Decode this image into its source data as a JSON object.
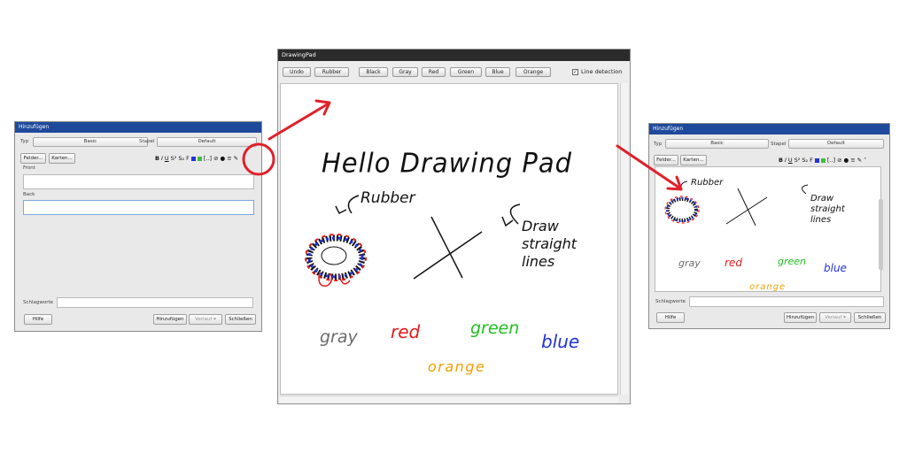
{
  "left_window": {
    "title": "Hinzufügen",
    "type_label": "Typ",
    "type_value": "Basic",
    "deck_label": "Stapel",
    "deck_value": "Default",
    "fields_button": "Felder...",
    "cards_button": "Karten...",
    "field_front": "Front",
    "field_back": "Back",
    "tags_label": "Schlagworte",
    "help_button": "Hilfe",
    "add_button": "Hinzufügen",
    "history_button": "Verlauf ▾",
    "close_button": "Schließen"
  },
  "right_window": {
    "title": "Hinzufügen",
    "type_label": "Typ",
    "type_value": "Basic",
    "deck_label": "Stapel",
    "deck_value": "Default",
    "fields_button": "Felder...",
    "cards_button": "Karten...",
    "tags_label": "Schlagworte",
    "help_button": "Hilfe",
    "add_button": "Hinzufügen",
    "history_button": "Verlauf ▾",
    "close_button": "Schließen",
    "drawing": {
      "rubber": "Rubber",
      "draw": "Draw",
      "straight": "straight",
      "lines": "lines",
      "gray": "gray",
      "red": "red",
      "green": "green",
      "blue": "blue",
      "orange": "orange"
    }
  },
  "drawing_pad": {
    "title": "DrawingPad",
    "buttons": {
      "undo": "Undo",
      "rubber": "Rubber",
      "black": "Black",
      "gray": "Gray",
      "red": "Red",
      "green": "Green",
      "blue": "Blue",
      "orange": "Orange"
    },
    "line_detection_label": "Line detection",
    "line_detection_checked": true,
    "canvas": {
      "heading": "Hello Drawing Pad",
      "rubber": "Rubber",
      "draw": "Draw",
      "straight": "straight",
      "lines": "lines",
      "gray": "gray",
      "red": "red",
      "green": "green",
      "blue": "blue",
      "orange": "orange"
    }
  },
  "colors": {
    "title_bar": "#1f4a9c",
    "pad_title_bar": "#2b2b2b",
    "annotation_red": "#e0202a",
    "ink_gray": "#6b6b6b",
    "ink_red": "#e31b1b",
    "ink_green": "#1fbf1f",
    "ink_blue": "#2233d6",
    "ink_orange": "#f0a000"
  },
  "icons": [
    "bold-icon",
    "italic-icon",
    "underline-icon",
    "superscript-icon",
    "subscript-icon",
    "text-color-icon",
    "highlight-icon",
    "cloze-icon",
    "attach-icon",
    "record-icon",
    "more-icon",
    "pen-icon"
  ]
}
